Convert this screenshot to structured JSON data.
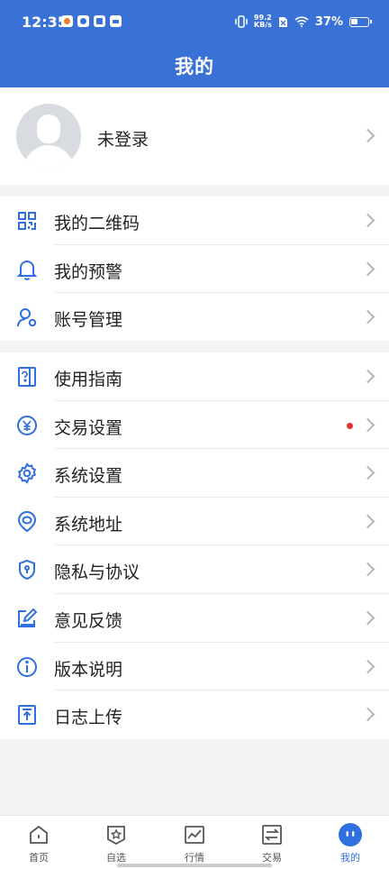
{
  "status_bar": {
    "time": "12:35",
    "net_speed_top": "99.2",
    "net_speed_bottom": "KB/s",
    "battery": "37%"
  },
  "header": {
    "title": "我的"
  },
  "profile": {
    "name": "未登录"
  },
  "menu_group_1": [
    {
      "label": "我的二维码",
      "icon": "qrcode-icon"
    },
    {
      "label": "我的预警",
      "icon": "bell-icon"
    },
    {
      "label": "账号管理",
      "icon": "user-settings-icon"
    }
  ],
  "menu_group_2": [
    {
      "label": "使用指南",
      "icon": "guide-icon"
    },
    {
      "label": "交易设置",
      "icon": "yen-icon",
      "badge": true
    },
    {
      "label": "系统设置",
      "icon": "gear-icon"
    },
    {
      "label": "系统地址",
      "icon": "location-icon"
    },
    {
      "label": "隐私与协议",
      "icon": "shield-icon"
    },
    {
      "label": "意见反馈",
      "icon": "edit-icon"
    },
    {
      "label": "版本说明",
      "icon": "info-icon"
    },
    {
      "label": "日志上传",
      "icon": "upload-icon"
    }
  ],
  "tabbar": [
    {
      "label": "首页",
      "icon": "home-icon"
    },
    {
      "label": "自选",
      "icon": "star-icon"
    },
    {
      "label": "行情",
      "icon": "chart-icon"
    },
    {
      "label": "交易",
      "icon": "exchange-icon"
    },
    {
      "label": "我的",
      "icon": "profile-icon",
      "active": true
    }
  ],
  "colors": {
    "brand": "#3a71d6",
    "accent": "#2f6fe0",
    "badge": "#e5322d"
  }
}
